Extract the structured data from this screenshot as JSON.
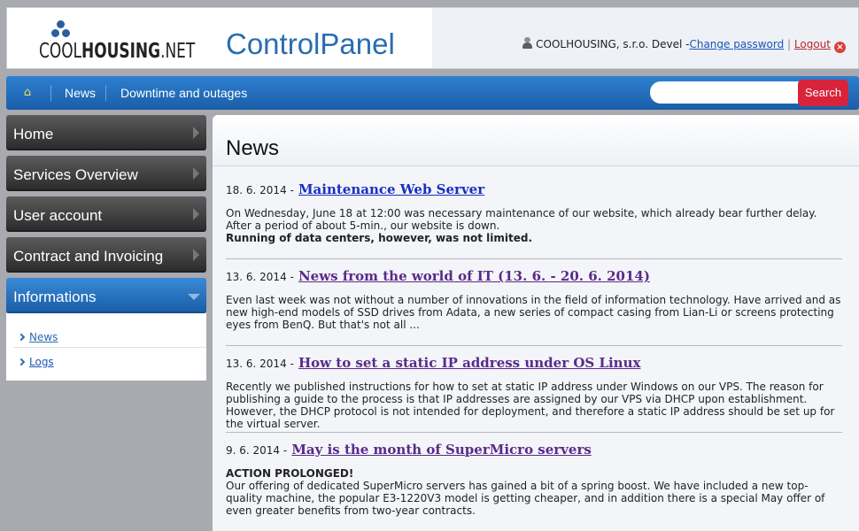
{
  "header": {
    "logo_text_light": "COOL",
    "logo_text_bold": "HOUSING",
    "logo_text_suffix": ".NET",
    "title": "ControlPanel",
    "user_name": "COOLHOUSING, s.r.o. Devel -",
    "change_password": "Change password",
    "separator": "|",
    "logout": "Logout"
  },
  "nav": {
    "home_icon": "home-icon",
    "items": [
      "News",
      "Downtime and outages"
    ],
    "search_placeholder": "",
    "search_button": "Search"
  },
  "sidebar": {
    "items": [
      {
        "label": "Home"
      },
      {
        "label": "Services Overview"
      },
      {
        "label": "User account"
      },
      {
        "label": "Contract and Invoicing"
      },
      {
        "label": "Informations"
      }
    ],
    "submenu": [
      "News",
      "Logs"
    ]
  },
  "main": {
    "title": "News",
    "articles": [
      {
        "date": "18. 6. 2014 -",
        "title": "Maintenance Web Server",
        "body": "On Wednesday, June 18 at 12:00 was necessary maintenance of our website, which already bear further delay. After a period of about 5-min., our website is down.",
        "body_bold": "Running of data centers, however, was not limited."
      },
      {
        "date": "13. 6. 2014 -",
        "title": "News from the world of IT (13. 6. - 20. 6. 2014)",
        "body": "Even last week was not without a number of innovations in the field of information technology. Have arrived and as new high-end models of SSD drives from Adata, a new series of compact casing from Lian-Li or screens protecting eyes from BenQ. But that's not all ..."
      },
      {
        "date": "13. 6. 2014 -",
        "title": "How to set a static IP address under OS Linux",
        "body": "Recently we published instructions for how to set at static IP address under Windows on our VPS. The reason for publishing a guide to the process is that IP addresses are assigned by our VPS via DHCP upon establishment. However, the DHCP protocol is not intended for deployment, and therefore a static IP address should be set up for the virtual server."
      },
      {
        "date": "9. 6. 2014 -",
        "title": "May is the month of SuperMicro servers",
        "body_bold": "ACTION PROLONGED!",
        "body": "Our offering of dedicated SuperMicro servers has gained a bit of a spring boost. We have included a new top-quality machine, the popular E3-1220V3 model is getting cheaper, and in addition there is a special May offer of even greater benefits from two-year contracts."
      }
    ]
  }
}
